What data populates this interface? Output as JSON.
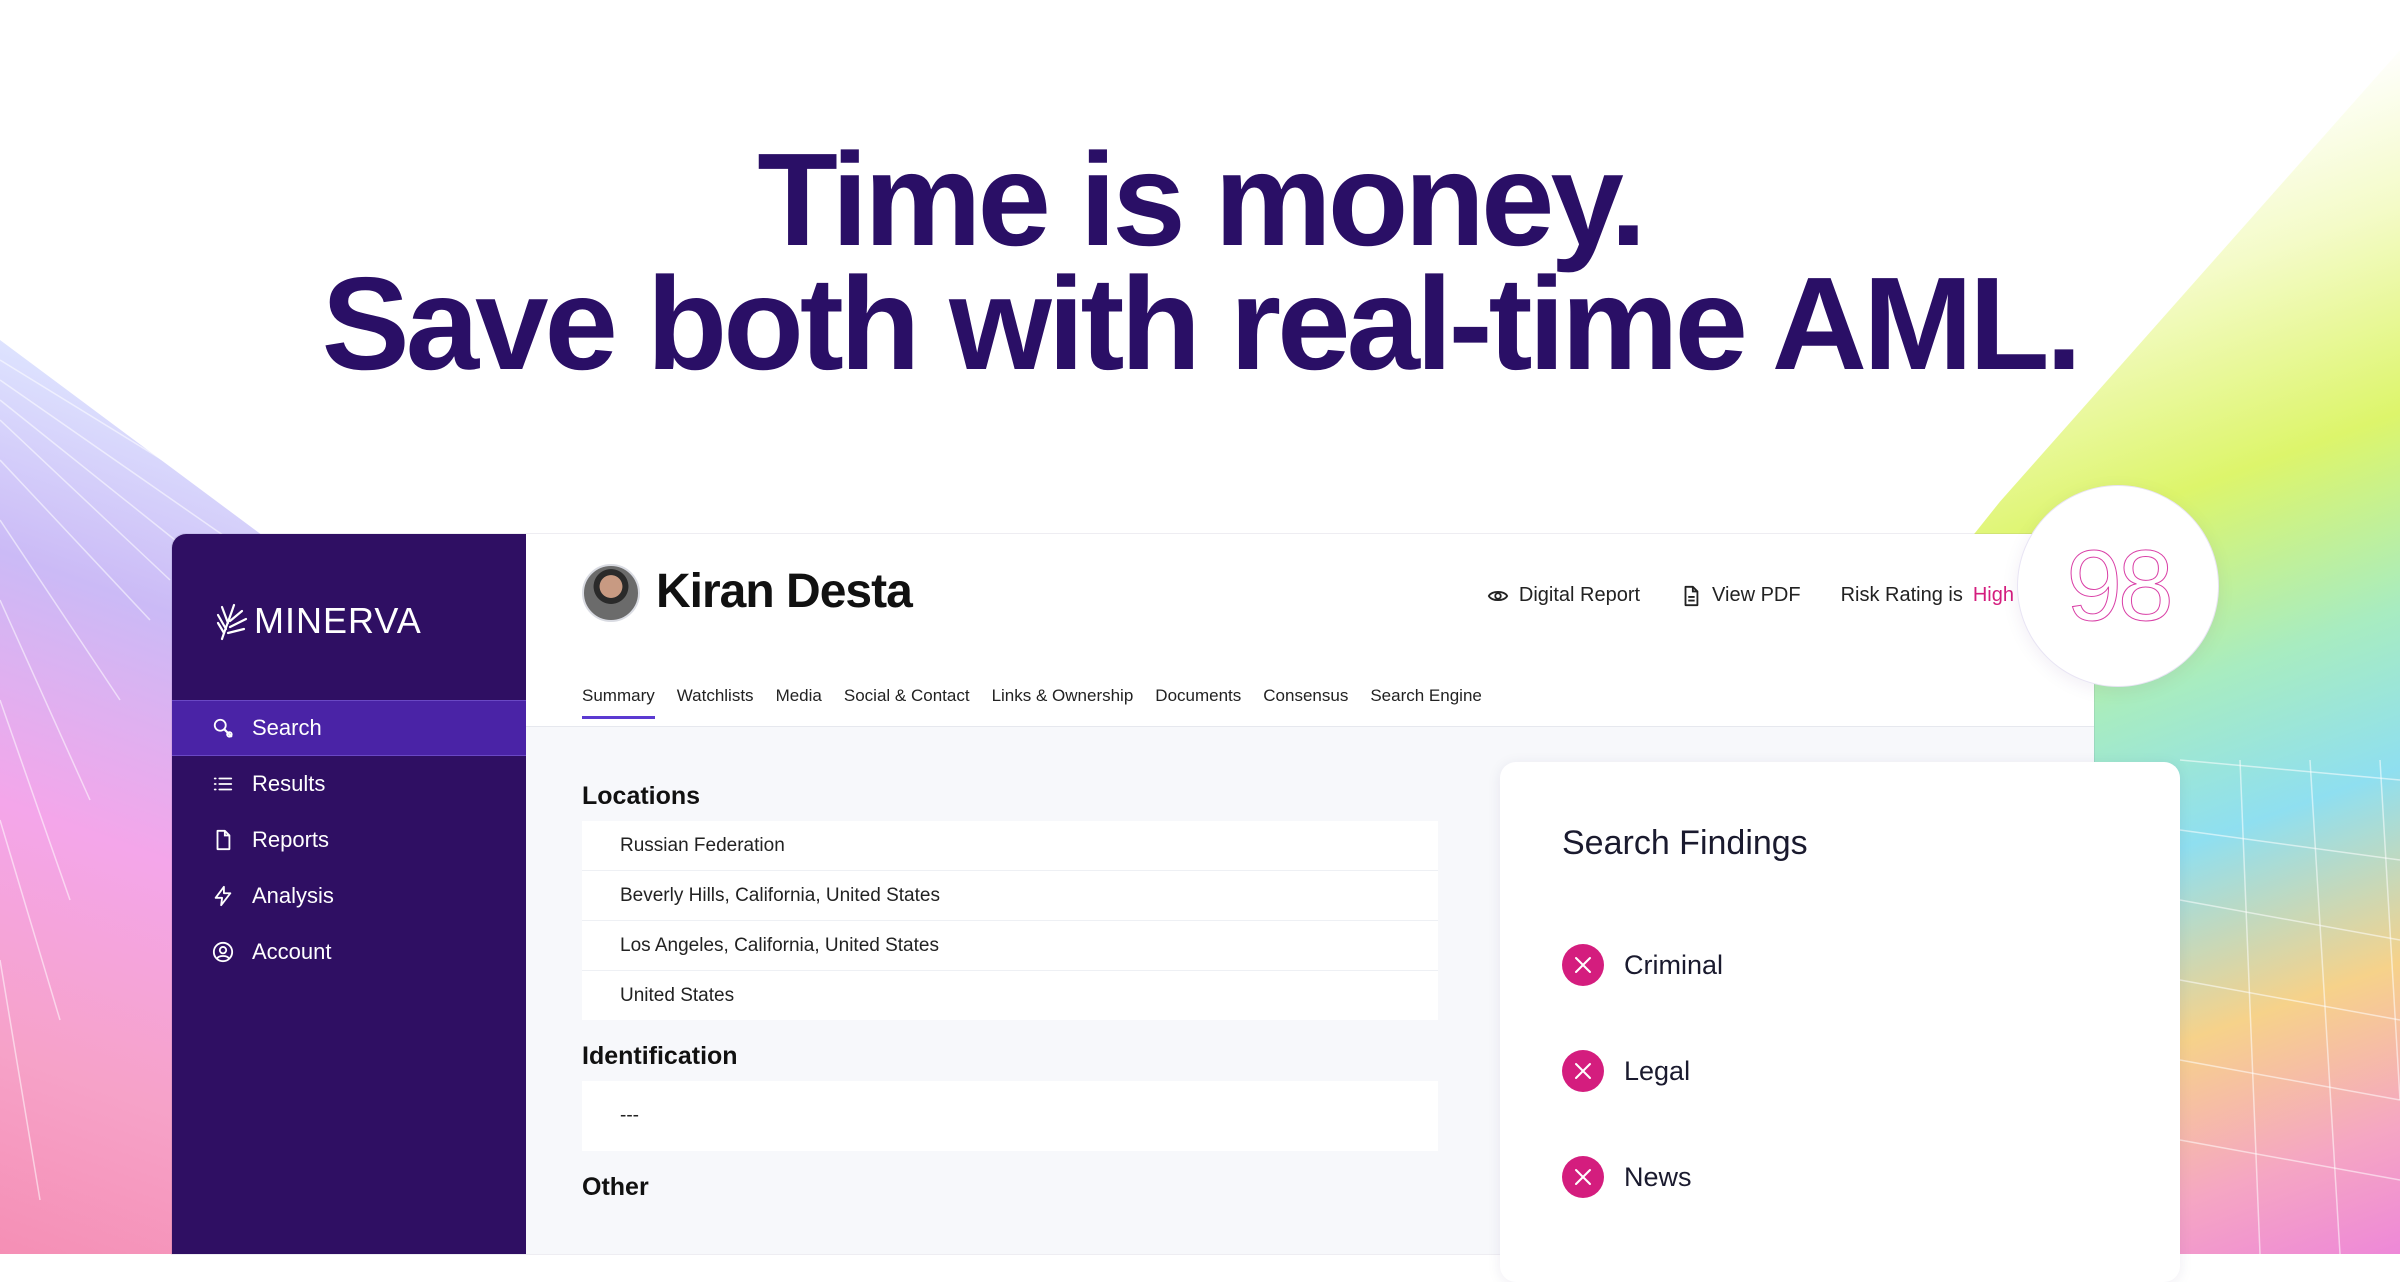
{
  "headline": {
    "line1": "Time is money.",
    "line2": "Save both with real-time AML."
  },
  "brand": {
    "name": "MINERVA",
    "primary_color": "#2f0f63",
    "accent_color": "#d41d7e"
  },
  "sidebar": {
    "items": [
      {
        "label": "Search",
        "icon": "search-icon",
        "active": true
      },
      {
        "label": "Results",
        "icon": "list-icon",
        "active": false
      },
      {
        "label": "Reports",
        "icon": "document-icon",
        "active": false
      },
      {
        "label": "Analysis",
        "icon": "lightning-icon",
        "active": false
      },
      {
        "label": "Account",
        "icon": "user-circle-icon",
        "active": false
      }
    ]
  },
  "profile": {
    "name": "Kiran Desta",
    "actions": {
      "digital_report": "Digital Report",
      "view_pdf": "View PDF",
      "risk_prefix": "Risk Rating is",
      "risk_value": "High"
    },
    "score": "98"
  },
  "tabs": [
    {
      "label": "Summary",
      "active": true
    },
    {
      "label": "Watchlists"
    },
    {
      "label": "Media"
    },
    {
      "label": "Social & Contact"
    },
    {
      "label": "Links & Ownership"
    },
    {
      "label": "Documents"
    },
    {
      "label": "Consensus"
    },
    {
      "label": "Search Engine"
    }
  ],
  "sections": {
    "locations": {
      "title": "Locations",
      "rows": [
        "Russian Federation",
        "Beverly Hills, California, United States",
        "Los Angeles, California, United States",
        "United States"
      ]
    },
    "identification": {
      "title": "Identification",
      "rows": [
        "---"
      ]
    },
    "other": {
      "title": "Other"
    }
  },
  "findings": {
    "title": "Search Findings",
    "items": [
      "Criminal",
      "Legal",
      "News"
    ]
  }
}
